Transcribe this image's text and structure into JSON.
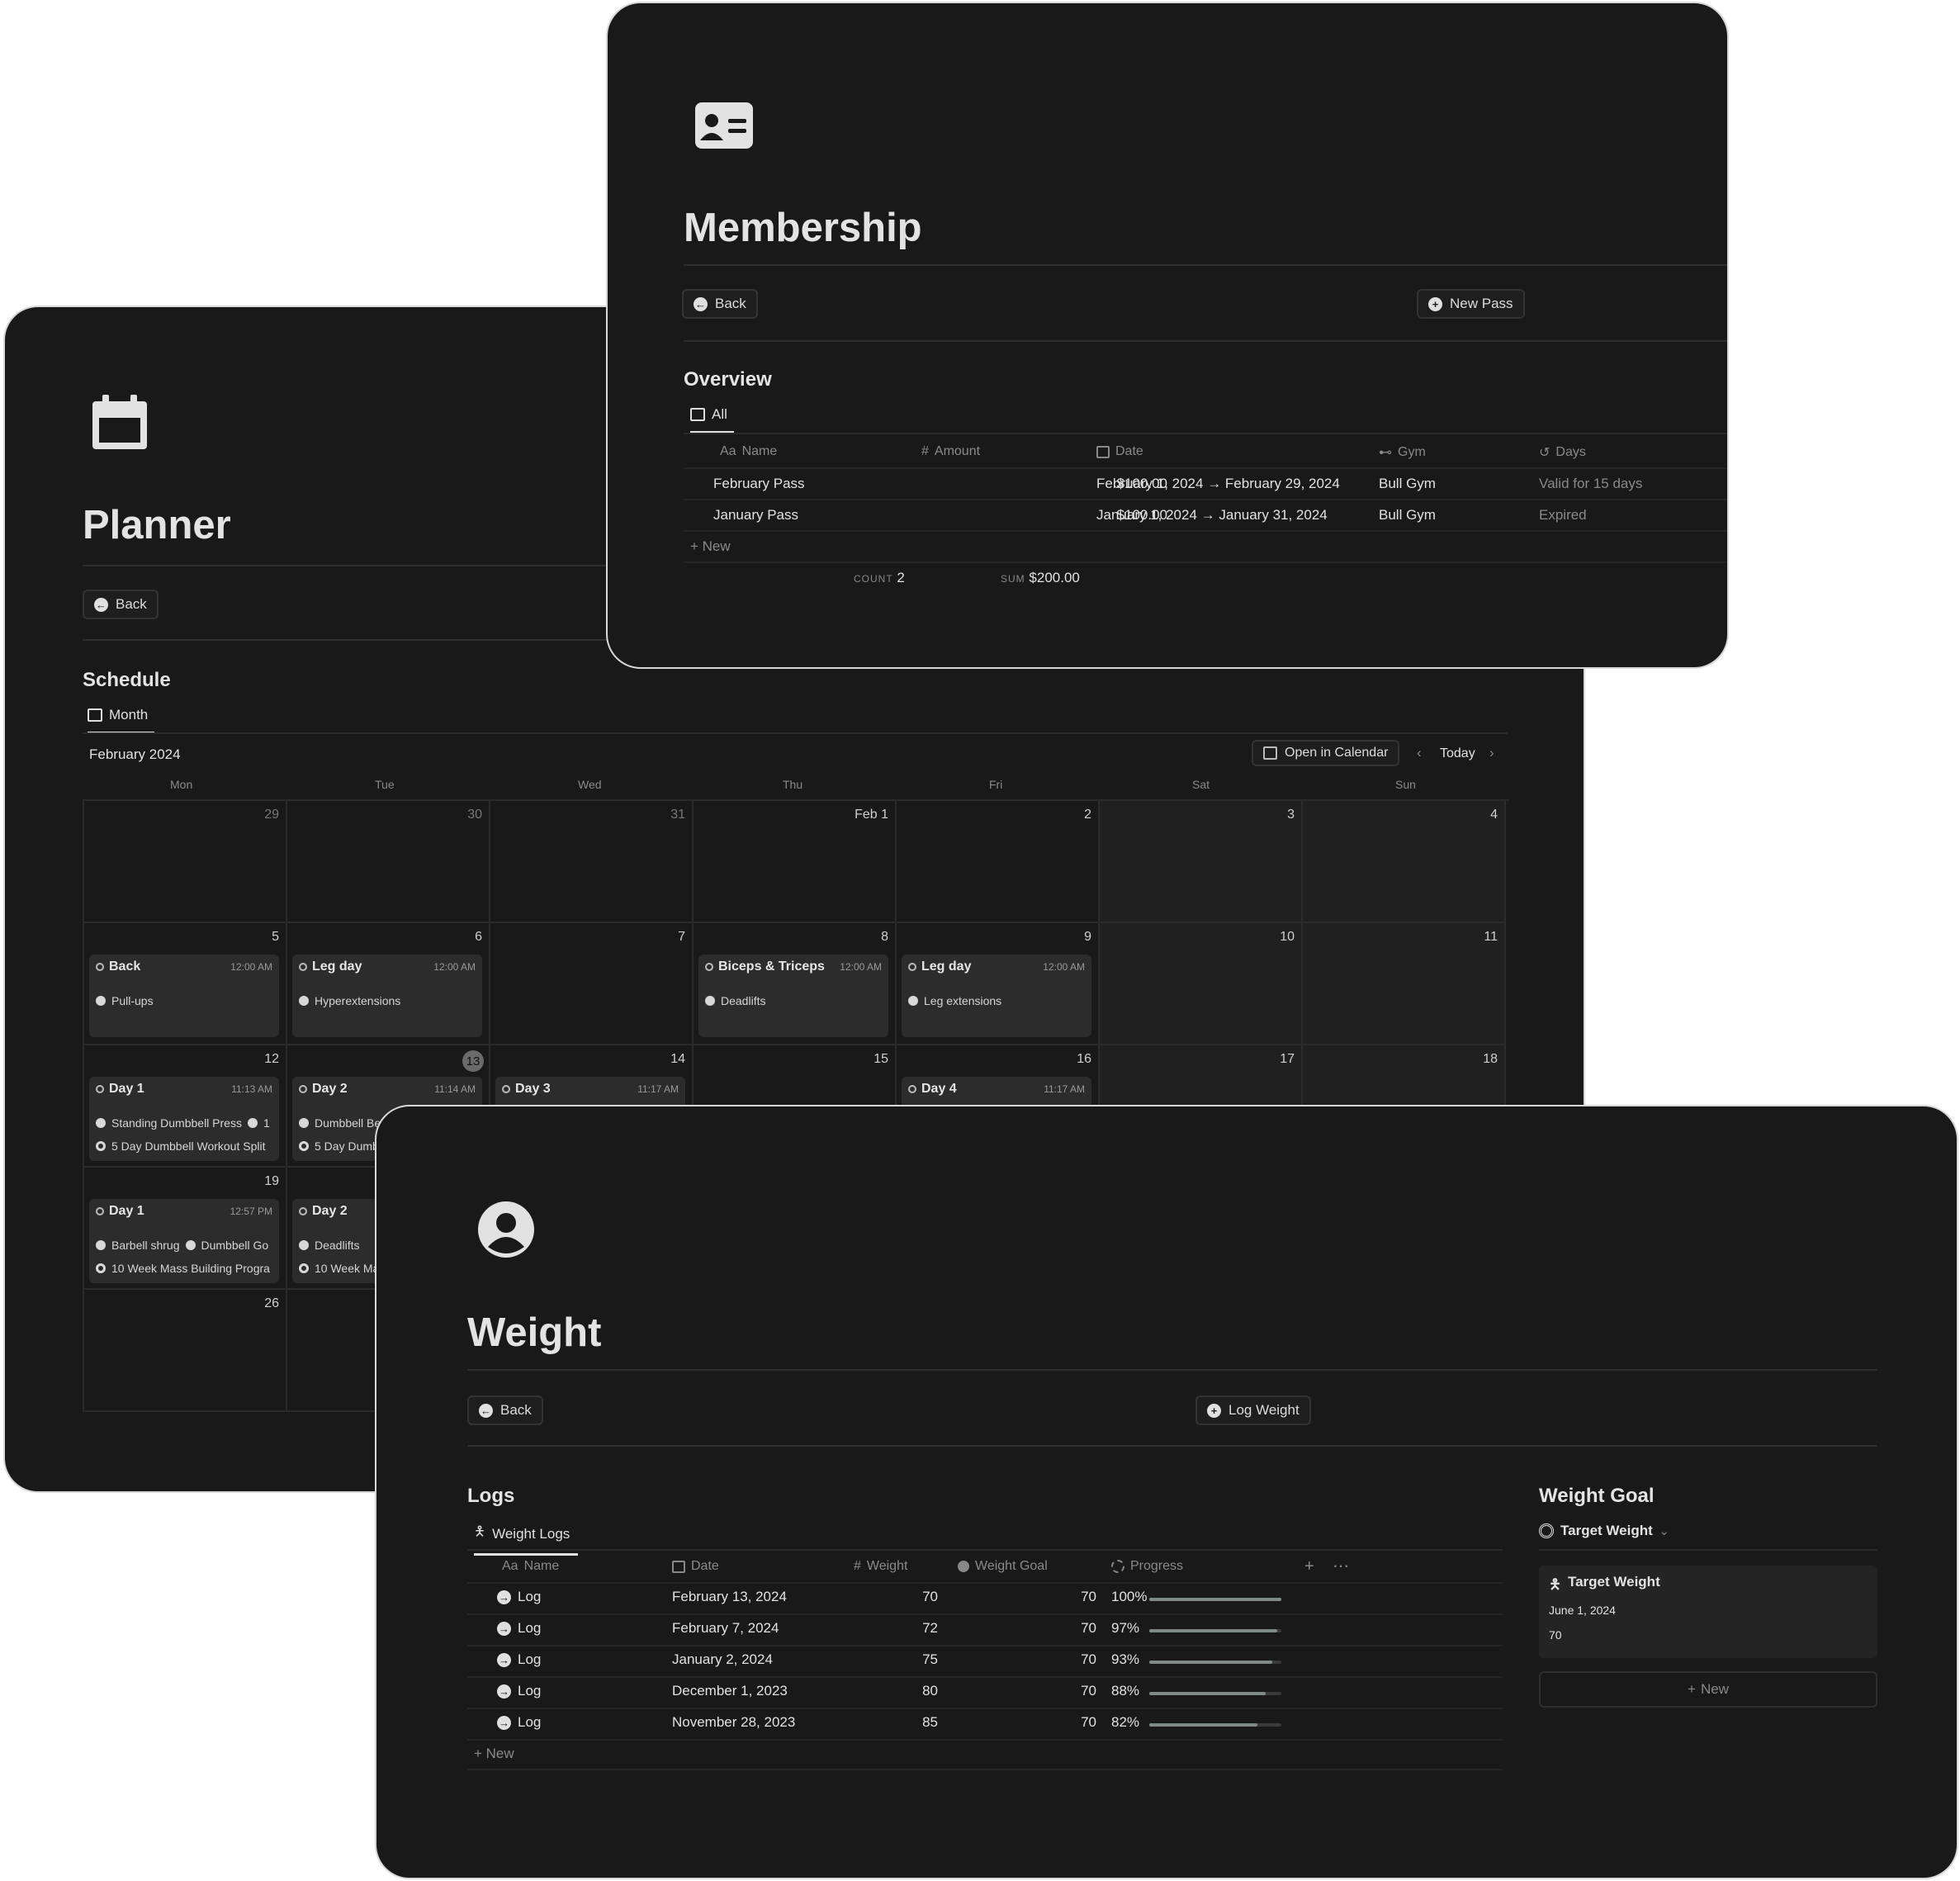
{
  "planner": {
    "title": "Planner",
    "back_label": "Back",
    "section": "Schedule",
    "tab": "Month",
    "month_label": "February 2024",
    "open_calendar_label": "Open in Calendar",
    "today_label": "Today",
    "weekdays": [
      "Mon",
      "Tue",
      "Wed",
      "Thu",
      "Fri",
      "Sat",
      "Sun"
    ],
    "days": [
      "29",
      "30",
      "31",
      "Feb 1",
      "2",
      "3",
      "4",
      "5",
      "6",
      "7",
      "8",
      "9",
      "10",
      "11",
      "12",
      "13",
      "14",
      "15",
      "16",
      "17",
      "18",
      "19",
      "26"
    ],
    "events": {
      "w2_mon": {
        "title": "Back",
        "time": "12:00 AM",
        "item": "Pull-ups"
      },
      "w2_tue": {
        "title": "Leg day",
        "time": "12:00 AM",
        "item": "Hyperextensions"
      },
      "w2_thu": {
        "title": "Biceps & Triceps",
        "time": "12:00 AM",
        "item": "Deadlifts"
      },
      "w2_fri": {
        "title": "Leg day",
        "time": "12:00 AM",
        "item": "Leg extensions"
      },
      "w3_mon": {
        "title": "Day 1",
        "time": "11:13 AM",
        "item": "Standing Dumbbell Press",
        "item_b": "1",
        "program": "5 Day Dumbbell Workout Split"
      },
      "w3_tue": {
        "title": "Day 2",
        "time": "11:14 AM",
        "item": "Dumbbell Be",
        "program": "5 Day Dumb"
      },
      "w3_wed": {
        "title": "Day 3",
        "time": "11:17 AM"
      },
      "w3_fri": {
        "title": "Day 4",
        "time": "11:17 AM"
      },
      "w4_mon": {
        "title": "Day 1",
        "time": "12:57 PM",
        "item": "Barbell shrug",
        "item_b": "Dumbbell Go",
        "program": "10 Week Mass Building Progra"
      },
      "w4_tue": {
        "title": "Day 2",
        "item": "Deadlifts",
        "program": "10 Week Ma"
      }
    }
  },
  "membership": {
    "title": "Membership",
    "back_label": "Back",
    "new_pass_label": "New Pass",
    "section": "Overview",
    "tab": "All",
    "columns": {
      "name": "Name",
      "amount": "Amount",
      "date": "Date",
      "gym": "Gym",
      "days": "Days"
    },
    "name_prefix": "Aa",
    "amount_prefix": "#",
    "rows": [
      {
        "name": "February Pass",
        "amount": "$100.00",
        "date": "February 1, 2024 → February 29, 2024",
        "gym": "Bull Gym",
        "days": "Valid for 15 days"
      },
      {
        "name": "January Pass",
        "amount": "$100.00",
        "date": "January 1, 2024 → January 31, 2024",
        "gym": "Bull Gym",
        "days": "Expired"
      }
    ],
    "new_label": "New",
    "count_label": "COUNT",
    "count_value": "2",
    "sum_label": "SUM",
    "sum_value": "$200.00"
  },
  "weight": {
    "title": "Weight",
    "back_label": "Back",
    "log_weight_label": "Log Weight",
    "logs_section": "Logs",
    "logs_tab": "Weight Logs",
    "columns": {
      "name": "Name",
      "date": "Date",
      "weight": "Weight",
      "goal": "Weight Goal",
      "progress": "Progress"
    },
    "name_prefix": "Aa",
    "weight_prefix": "#",
    "rows": [
      {
        "name": "Log",
        "date": "February 13, 2024",
        "weight": "70",
        "goal": "70",
        "progress_label": "100%",
        "progress": 1.0
      },
      {
        "name": "Log",
        "date": "February 7, 2024",
        "weight": "72",
        "goal": "70",
        "progress_label": "97%",
        "progress": 0.97
      },
      {
        "name": "Log",
        "date": "January 2, 2024",
        "weight": "75",
        "goal": "70",
        "progress_label": "93%",
        "progress": 0.93
      },
      {
        "name": "Log",
        "date": "December 1, 2023",
        "weight": "80",
        "goal": "70",
        "progress_label": "88%",
        "progress": 0.88
      },
      {
        "name": "Log",
        "date": "November 28, 2023",
        "weight": "85",
        "goal": "70",
        "progress_label": "82%",
        "progress": 0.82
      }
    ],
    "new_label": "New",
    "goal_section": "Weight Goal",
    "goal_tab": "Target Weight",
    "goal_card": {
      "title": "Target Weight",
      "date": "June 1, 2024",
      "value": "70"
    },
    "goal_new_label": "New"
  }
}
